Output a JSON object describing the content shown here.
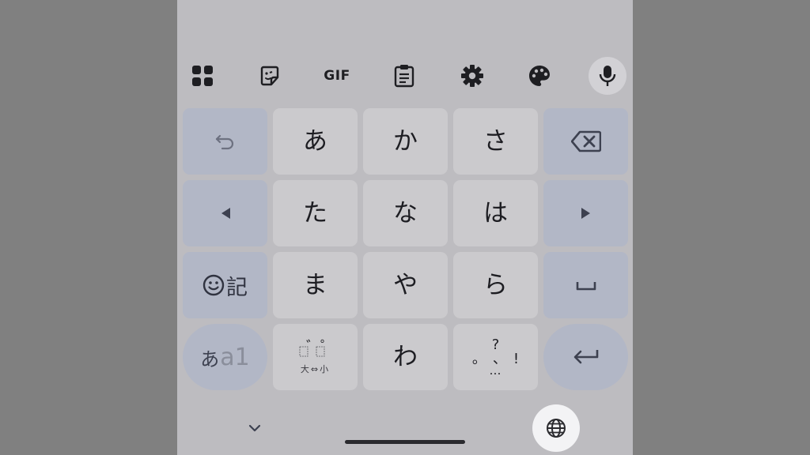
{
  "toolbar": {
    "items": [
      "apps-grid-icon",
      "sticker-icon",
      "gif",
      "clipboard-icon",
      "gear-icon",
      "palette-icon",
      "microphone-icon"
    ],
    "gif_label": "GIF"
  },
  "keys": {
    "row1": [
      "あ",
      "か",
      "さ"
    ],
    "row2": [
      "た",
      "な",
      "は"
    ],
    "row3": [
      "ま",
      "や",
      "ら"
    ],
    "row4_center": "わ",
    "symbol_label": "記",
    "kana_switch": {
      "primary": "あ",
      "secondary": "a1"
    },
    "dakuten": {
      "marks": "゛゜",
      "sub": "大⇔小"
    },
    "punct": {
      "top": "?",
      "left": "。",
      "middle": "、",
      "right": "!",
      "bottom": "…"
    }
  },
  "nav": {
    "icons": [
      "chevron-down-icon",
      "home-indicator",
      "globe-icon"
    ]
  },
  "colors": {
    "background": "#808080",
    "keyboard": "#bdbcc0",
    "char_key": "#cbcacd",
    "function_key": "#b2b7c6",
    "globe_button": "#f3f3f5"
  }
}
